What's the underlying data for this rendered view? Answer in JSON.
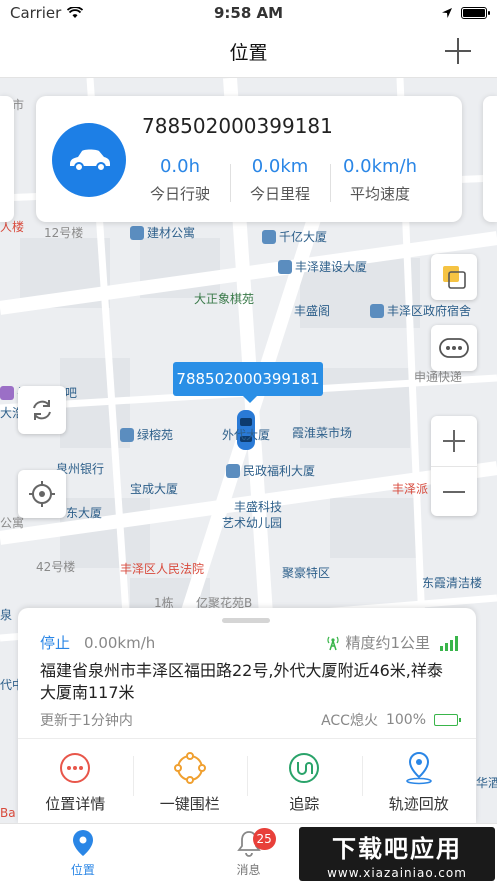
{
  "status_bar": {
    "carrier": "Carrier",
    "time": "9:58 AM"
  },
  "nav": {
    "title": "位置"
  },
  "vehicle": {
    "device_id": "788502000399181",
    "stats": [
      {
        "value": "0.0h",
        "label": "今日行驶"
      },
      {
        "value": "0.0km",
        "label": "今日里程"
      },
      {
        "value": "0.0km/h",
        "label": "平均速度"
      }
    ]
  },
  "map": {
    "callout": "788502000399181",
    "pois": [
      "州市",
      "人楼",
      "12号楼",
      "建材公寓",
      "千亿大厦",
      "丰泽建设大厦",
      "大正象棋苑",
      "丰泽区政府宿舍",
      "丰盛阁",
      "申通快递",
      "寻乐园网吧",
      "大浩",
      "绿榕苑",
      "外代大厦",
      "霞淮菜市场",
      "泉州银行",
      "民政福利大厦",
      "宝成大厦",
      "丰泽派",
      "丰盛科技",
      "艺术幼儿园",
      "东大厦",
      "公寓",
      "42号楼",
      "丰泽区人民法院",
      "聚豪特区",
      "东霞清洁楼",
      "1栋",
      "亿聚花苑B",
      "泉",
      "代中",
      "华酒",
      "Ba"
    ]
  },
  "sheet": {
    "state": "停止",
    "speed": "0.00km/h",
    "precision": "精度约1公里",
    "address": "福建省泉州市丰泽区福田路22号,外代大厦附近46米,祥泰大厦南117米",
    "updated": "更新于1分钟内",
    "acc": "ACC熄火",
    "battery": "100%",
    "battery_level": 1.0,
    "signal_bars": 4,
    "actions": [
      {
        "label": "位置详情",
        "icon": "more-dots-icon",
        "color": "#e8564a"
      },
      {
        "label": "一键围栏",
        "icon": "fence-circle-icon",
        "color": "#f0a030"
      },
      {
        "label": "追踪",
        "icon": "track-u-icon",
        "color": "#2aa36a"
      },
      {
        "label": "轨迹回放",
        "icon": "location-pin-icon",
        "color": "#2a86e6"
      }
    ]
  },
  "tabs": [
    {
      "label": "位置",
      "icon": "location-pin-icon",
      "active": true
    },
    {
      "label": "消息",
      "icon": "bell-icon",
      "badge": "25"
    },
    {
      "label": "",
      "icon": ""
    }
  ],
  "watermark": {
    "title": "下载吧应用",
    "url": "www.xiazainiao.com"
  },
  "colors": {
    "accent": "#2a86e6",
    "badge": "#e8403a",
    "signal": "#39b54a"
  }
}
